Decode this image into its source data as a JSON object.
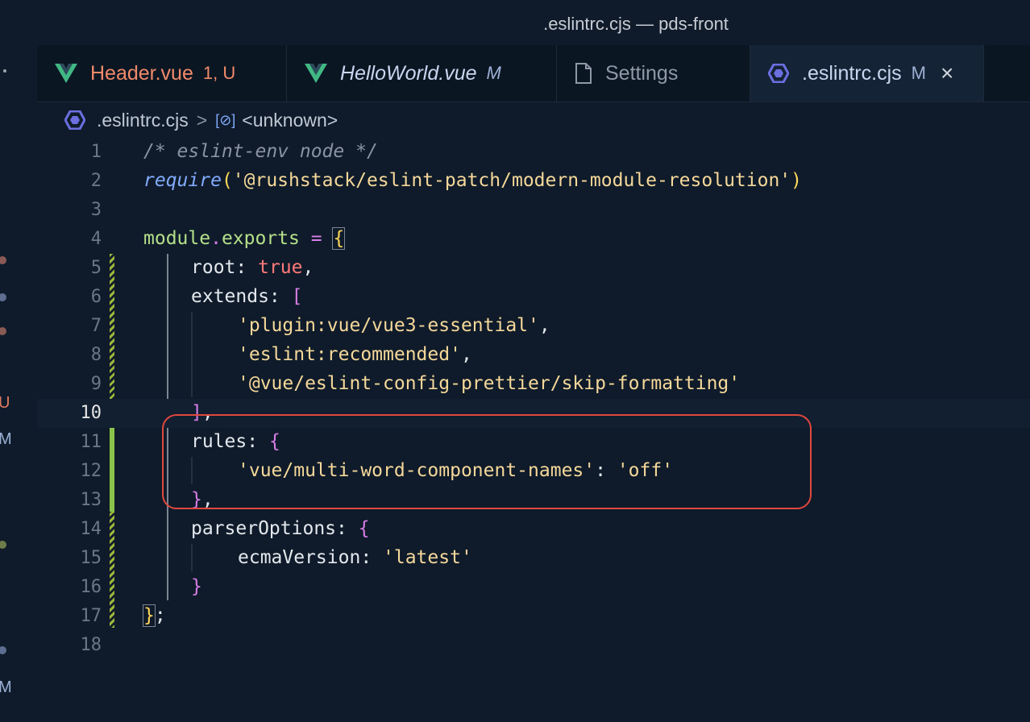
{
  "window": {
    "title": ".eslintrc.cjs — pds-front"
  },
  "left_strip": {
    "letters": [
      "U",
      "M",
      "M"
    ]
  },
  "tabs": [
    {
      "label": "Header.vue",
      "badge": "1, U",
      "icon": "vue-icon",
      "label_color": "#f08a69",
      "badge_color": "#f08a69"
    },
    {
      "label": "HelloWorld.vue",
      "badge": "M",
      "icon": "vue-icon",
      "label_color": "#c9d6f0",
      "badge_color": "#c9d6f0"
    },
    {
      "label": "Settings",
      "badge": "",
      "icon": "file-icon",
      "label_color": "#8f98a6",
      "badge_color": ""
    },
    {
      "label": ".eslintrc.cjs",
      "badge": "M",
      "icon": "eslint-icon",
      "label_color": "#c9d6f0",
      "badge_color": "#c9d6f0",
      "close": "×"
    }
  ],
  "breadcrumb": {
    "file": ".eslintrc.cjs",
    "separator": ">",
    "symbol_icon": "[⊘]",
    "symbol": "<unknown>"
  },
  "editor": {
    "line_numbers": [
      "1",
      "2",
      "3",
      "4",
      "5",
      "6",
      "7",
      "8",
      "9",
      "10",
      "11",
      "12",
      "13",
      "14",
      "15",
      "16",
      "17",
      "18"
    ],
    "current_line": "10",
    "lines": {
      "l1": "/* eslint-env node */",
      "l2_fn": "require",
      "l2_open": "(",
      "l2_str": "'@rushstack/eslint-patch/modern-module-resolution'",
      "l2_close": ")",
      "l4_module": "module",
      "l4_dot": ".",
      "l4_exports": "exports",
      "l4_eq": " = ",
      "l4_brace": "{",
      "l5_key": "root: ",
      "l5_val": "true",
      "l5_comma": ",",
      "l6_key": "extends: ",
      "l6_br": "[",
      "l7_str": "'plugin:vue/vue3-essential'",
      "l7_comma": ",",
      "l8_str": "'eslint:recommended'",
      "l8_comma": ",",
      "l9_str": "'@vue/eslint-config-prettier/skip-formatting'",
      "l10_br": "]",
      "l10_comma": ",",
      "l11_key": "rules: ",
      "l11_br": "{",
      "l12_str": "'vue/multi-word-component-names'",
      "l12_colon": ": ",
      "l12_val": "'off'",
      "l13_br": "}",
      "l13_comma": ",",
      "l14_key": "parserOptions: ",
      "l14_br": "{",
      "l15_key": "ecmaVersion: ",
      "l15_val": "'latest'",
      "l16_br": "}",
      "l17_br": "}",
      "l17_semi": ";"
    }
  },
  "colors": {
    "background": "#0f1b2a",
    "annotation_box": "#e0483e",
    "modified_gutter": "#8bc34a"
  }
}
